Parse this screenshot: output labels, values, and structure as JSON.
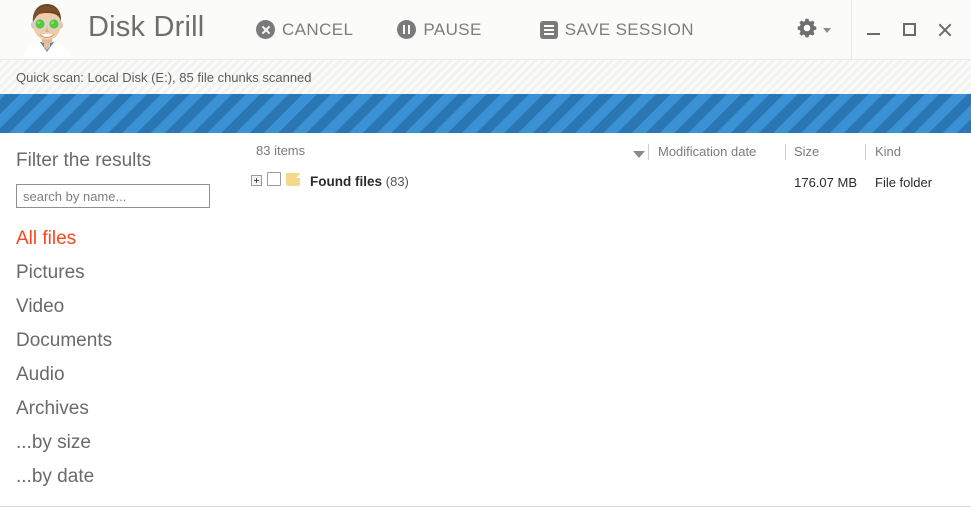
{
  "window": {
    "app_title": "Disk Drill",
    "logo_icon": "scientist-avatar-icon",
    "controls": {
      "minimize_icon": "minimize-icon",
      "maximize_icon": "maximize-icon",
      "close_icon": "close-icon"
    },
    "settings": {
      "gear_icon": "gear-icon",
      "caret_icon": "chevron-down-icon"
    }
  },
  "toolbar": {
    "buttons": [
      {
        "id": "cancel",
        "label": "CANCEL",
        "icon": "cancel-circle-icon"
      },
      {
        "id": "pause",
        "label": "PAUSE",
        "icon": "pause-circle-icon"
      },
      {
        "id": "save_session",
        "label": "SAVE SESSION",
        "icon": "list-square-icon"
      }
    ]
  },
  "status": {
    "text": "Quick scan: Local Disk (E:), 85 file chunks scanned"
  },
  "progress": {
    "style": "striped-indeterminate",
    "color": "#2f81c2",
    "stripe_color": "#3a92d4"
  },
  "sidebar": {
    "title": "Filter the results",
    "search": {
      "placeholder": "search by name...",
      "value": ""
    },
    "items": [
      {
        "label": "All files",
        "active": true
      },
      {
        "label": "Pictures",
        "active": false
      },
      {
        "label": "Video",
        "active": false
      },
      {
        "label": "Documents",
        "active": false
      },
      {
        "label": "Audio",
        "active": false
      },
      {
        "label": "Archives",
        "active": false
      },
      {
        "label": "...by size",
        "active": false
      },
      {
        "label": "...by date",
        "active": false
      }
    ],
    "accent_color": "#f9461c"
  },
  "filepane": {
    "items_count_label": "83 items",
    "sort_caret_icon": "sort-descending-icon",
    "columns": [
      {
        "id": "name",
        "label": ""
      },
      {
        "id": "modification_date",
        "label": "Modification date"
      },
      {
        "id": "size",
        "label": "Size"
      },
      {
        "id": "kind",
        "label": "Kind"
      }
    ],
    "rows": [
      {
        "expander_icon": "expand-plus-icon",
        "checked": false,
        "icon": "folder-icon",
        "name": "Found files",
        "child_count": "(83)",
        "modification_date": "",
        "size": "176.07 MB",
        "kind": "File folder"
      }
    ]
  }
}
